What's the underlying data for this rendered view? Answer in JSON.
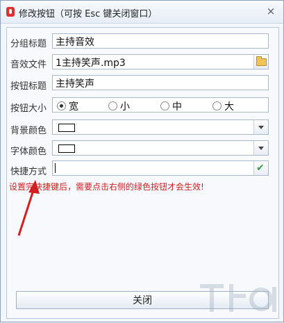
{
  "window": {
    "title": "修改按钮（可按 Esc 键关闭窗口）",
    "close_symbol": "×"
  },
  "form": {
    "group_title": {
      "label": "分组标题",
      "value": "主持音效"
    },
    "sound_file": {
      "label": "音效文件",
      "value": "1主持笑声.mp3",
      "browse_icon": "folder-icon"
    },
    "button_title": {
      "label": "按钮标题",
      "value": "主持笑声"
    },
    "button_size": {
      "label": "按钮大小",
      "options": [
        "宽",
        "小",
        "中",
        "大"
      ],
      "selected": "宽"
    },
    "bg_color": {
      "label": "背景颜色",
      "value": "#ffffff"
    },
    "font_color": {
      "label": "字体颜色",
      "value": "#ffffff"
    },
    "shortcut": {
      "label": "快捷方式",
      "value": "",
      "confirm_icon": "check-icon"
    }
  },
  "tip": "设置完快捷键后，需要点击右侧的绿色按钮才会生效!",
  "footer": {
    "close_label": "关闭"
  },
  "colors": {
    "tip": "#d02020",
    "arrow": "#d02020",
    "confirm": "#3e9b3e"
  }
}
